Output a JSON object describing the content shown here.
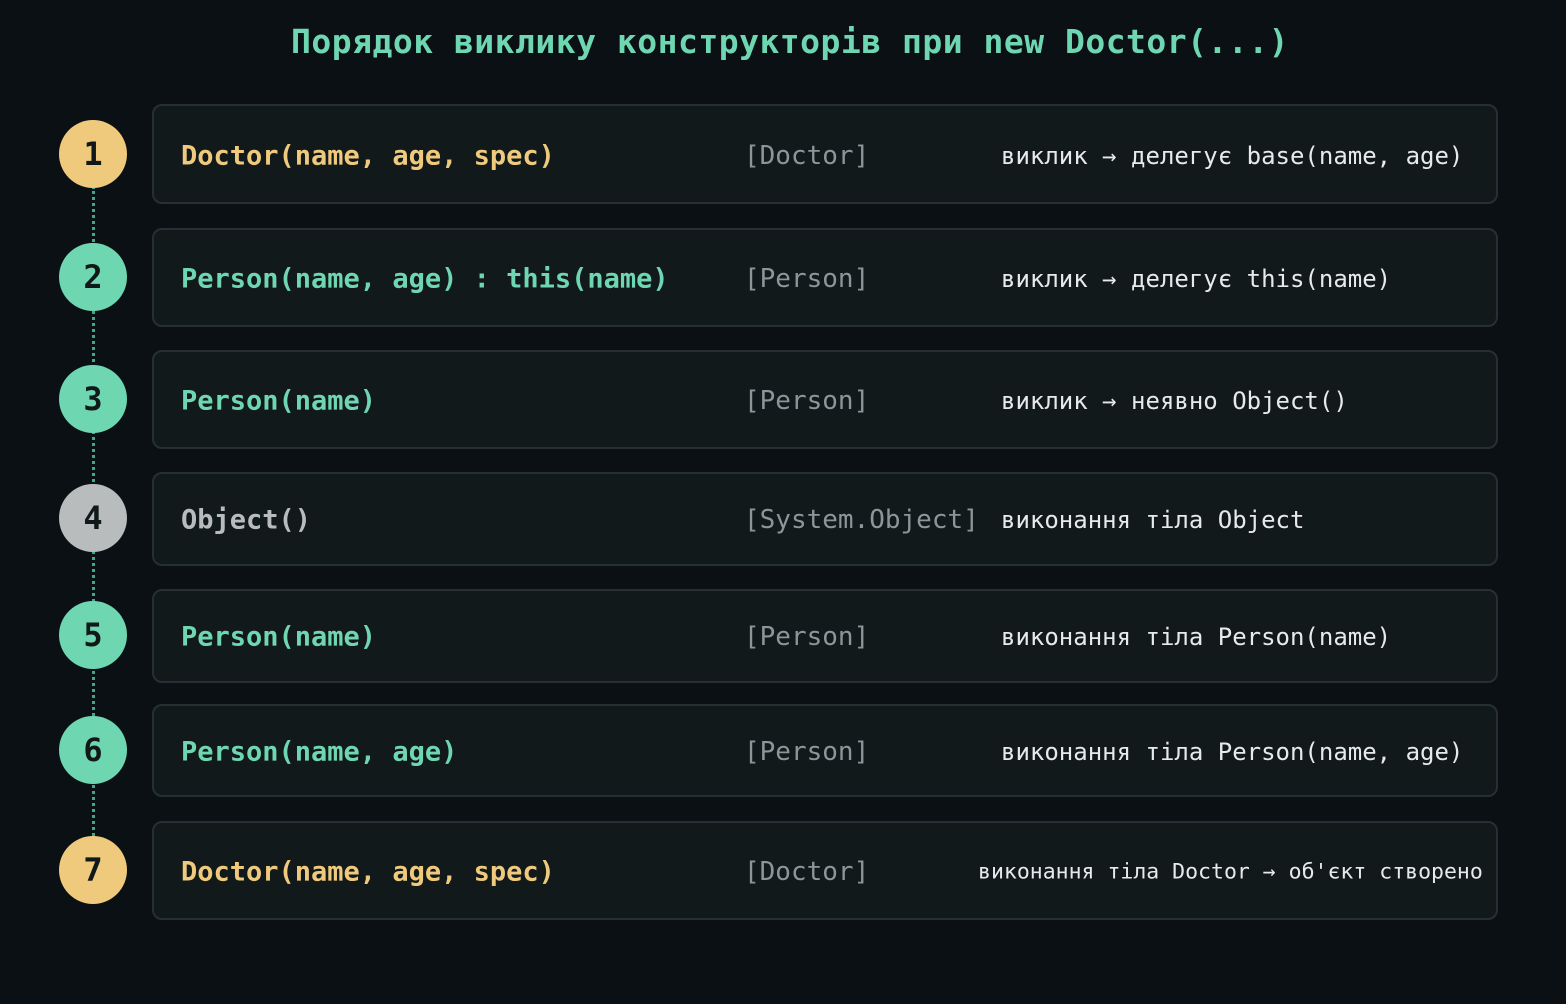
{
  "title": "Порядок виклику конструкторів при new Doctor(...)",
  "colors": {
    "background": "#0a1013",
    "title": "#6fd6b2",
    "doctor": "#efca7c",
    "person": "#6fd6b2",
    "object": "#b9bcbd",
    "class_label": "#8c9598",
    "description": "#e6eaea",
    "connector": "#3fa887"
  },
  "steps": [
    {
      "number": "1",
      "signature": "Doctor(name, age, spec)",
      "class_label": "[Doctor]",
      "description": "виклик → делегує base(name, age)",
      "kind": "doctor"
    },
    {
      "number": "2",
      "signature": "Person(name, age) : this(name)",
      "class_label": "[Person]",
      "description": "виклик → делегує this(name)",
      "kind": "person"
    },
    {
      "number": "3",
      "signature": "Person(name)",
      "class_label": "[Person]",
      "description": "виклик → неявно Object()",
      "kind": "person"
    },
    {
      "number": "4",
      "signature": "Object()",
      "class_label": "[System.Object]",
      "description": "виконання тіла Object",
      "kind": "object"
    },
    {
      "number": "5",
      "signature": "Person(name)",
      "class_label": "[Person]",
      "description": "виконання тіла Person(name)",
      "kind": "person"
    },
    {
      "number": "6",
      "signature": "Person(name, age)",
      "class_label": "[Person]",
      "description": "виконання тіла Person(name, age)",
      "kind": "person"
    },
    {
      "number": "7",
      "signature": "Doctor(name, age, spec)",
      "class_label": "[Doctor]",
      "description": "виконання тіла Doctor → об'єкт створено",
      "kind": "doctor"
    }
  ]
}
